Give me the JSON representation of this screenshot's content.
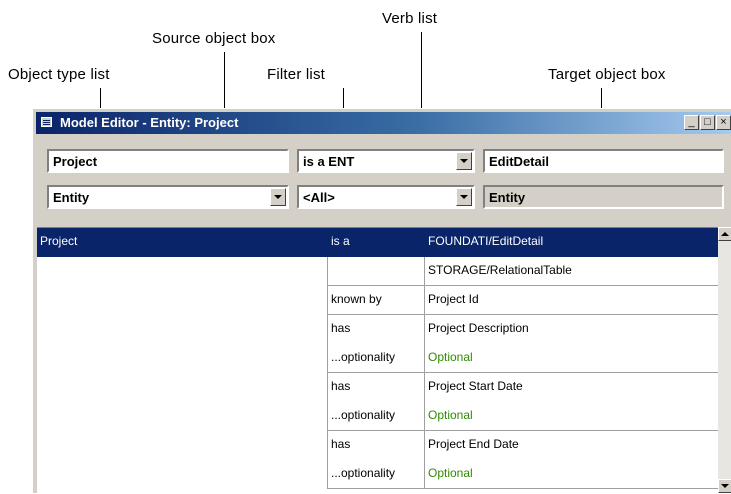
{
  "callouts": {
    "object_type_list": "Object type list",
    "source_object_box": "Source object box",
    "filter_list": "Filter list",
    "verb_list": "Verb list",
    "target_object_box": "Target object box"
  },
  "window": {
    "title": "Model Editor - Entity: Project",
    "minimize": "_",
    "maximize": "□",
    "close": "×"
  },
  "controls": {
    "source_object": "Project",
    "verb": "is a ENT",
    "target_object": "EditDetail",
    "object_type": "Entity",
    "filter": "<All>",
    "target_type": "Entity"
  },
  "grid": {
    "rows": [
      {
        "source": "Project",
        "verb": "is a",
        "target": "FOUNDATI/EditDetail",
        "selected": true
      },
      {
        "source": "",
        "verb": "",
        "target": "STORAGE/RelationalTable"
      },
      {
        "source": "",
        "verb": "known by",
        "target": "Project Id"
      },
      {
        "source": "",
        "verb": "has",
        "target": "Project Description"
      },
      {
        "source": "",
        "verb": "...optionality",
        "target": "Optional",
        "green": true
      },
      {
        "source": "",
        "verb": "has",
        "target": "Project Start Date"
      },
      {
        "source": "",
        "verb": "...optionality",
        "target": "Optional",
        "green": true
      },
      {
        "source": "",
        "verb": "has",
        "target": "Project End Date"
      },
      {
        "source": "",
        "verb": "...optionality",
        "target": "Optional",
        "green": true
      }
    ]
  },
  "colors": {
    "title_start": "#0a246a",
    "title_end": "#a6caf0",
    "selection": "#0a246a",
    "optional_text": "#2e8b00",
    "window_face": "#d4d0c8"
  }
}
